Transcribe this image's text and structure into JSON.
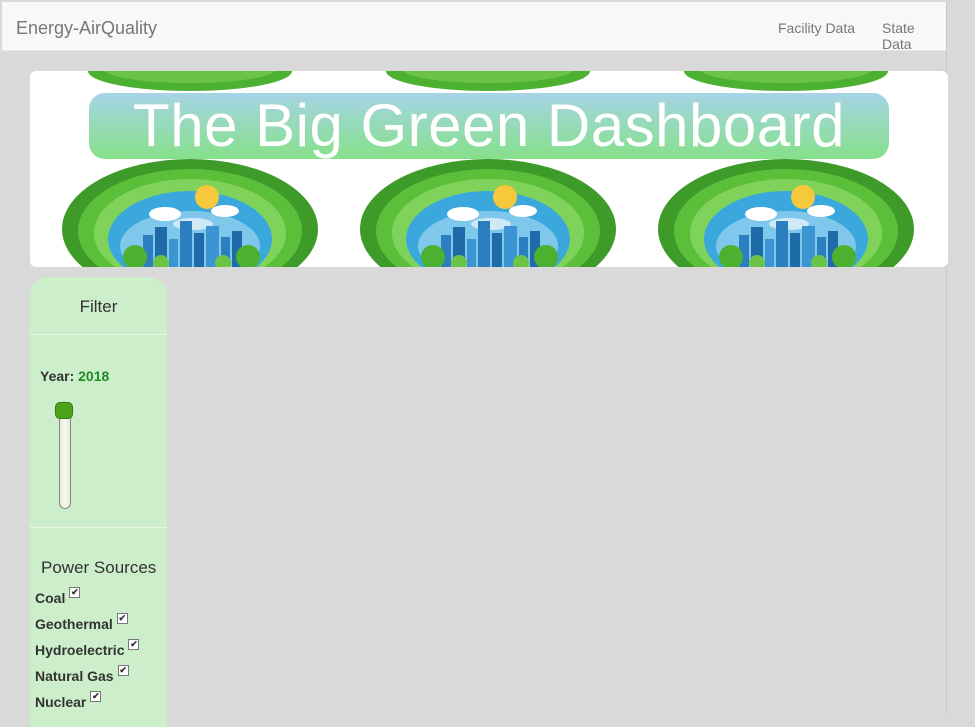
{
  "navbar": {
    "brand": "Energy-AirQuality",
    "links": [
      "Facility Data",
      "State Data"
    ]
  },
  "banner": {
    "title": "The Big Green Dashboard"
  },
  "filter": {
    "title": "Filter",
    "year_label": "Year:",
    "year_value": "2018",
    "power_sources_title": "Power Sources",
    "sources": [
      {
        "label": "Coal",
        "checked": true
      },
      {
        "label": "Geothermal",
        "checked": true
      },
      {
        "label": "Hydroelectric",
        "checked": true
      },
      {
        "label": "Natural Gas",
        "checked": true
      },
      {
        "label": "Nuclear",
        "checked": true
      }
    ],
    "check_glyph": "✔"
  },
  "colors": {
    "page_bg": "#d9d9d9",
    "panel_bg": "#cdeecb",
    "slider_handle": "#4aa31b",
    "year_value": "#1f8a23"
  }
}
